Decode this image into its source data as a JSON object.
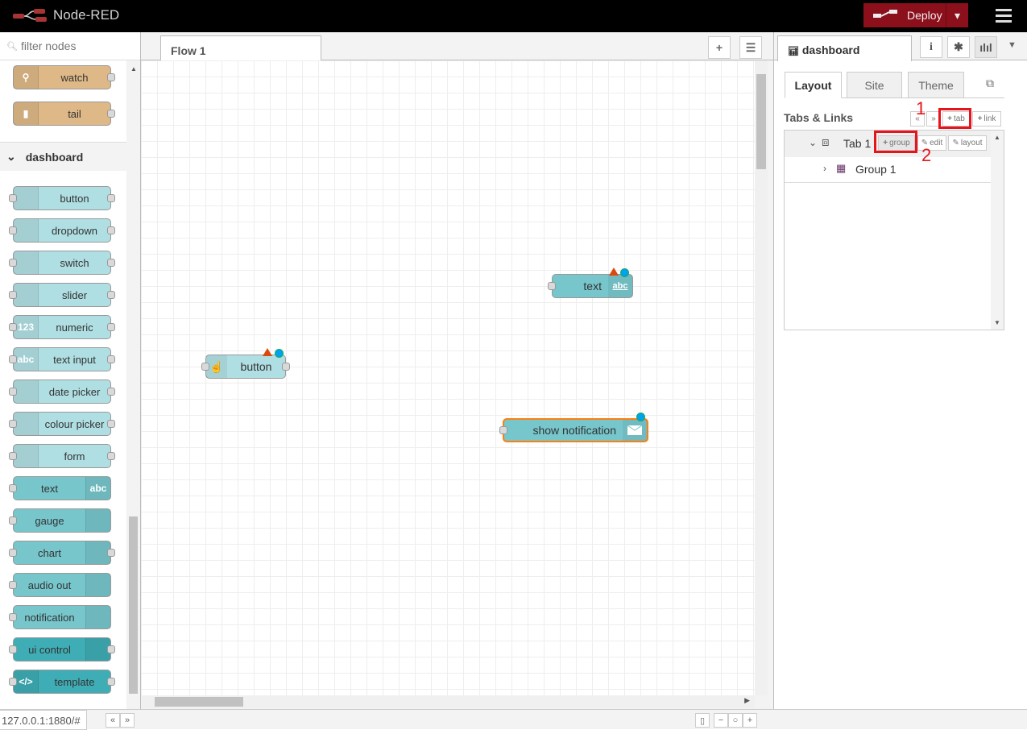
{
  "header": {
    "title": "Node-RED",
    "deploy_label": "Deploy"
  },
  "palette": {
    "filter_placeholder": "filter nodes",
    "category": "dashboard",
    "colors": {
      "input": "#b0dfe3",
      "output": "#77c6cc",
      "control": "#3fadb5",
      "common": "#deb887"
    },
    "common_nodes": [
      {
        "label": "watch",
        "icon": "magnifier-icon"
      },
      {
        "label": "tail",
        "icon": "file-icon"
      }
    ],
    "nodes": [
      {
        "label": "button",
        "icon": "hand-icon",
        "kind": "input",
        "side": "l",
        "in": true,
        "out": true
      },
      {
        "label": "dropdown",
        "icon": "list-icon",
        "kind": "input",
        "side": "l",
        "in": true,
        "out": true
      },
      {
        "label": "switch",
        "icon": "toggle-icon",
        "kind": "input",
        "side": "l",
        "in": true,
        "out": true
      },
      {
        "label": "slider",
        "icon": "sliders-icon",
        "kind": "input",
        "side": "l",
        "in": true,
        "out": true
      },
      {
        "label": "numeric",
        "icon": "numeric-icon",
        "kind": "input",
        "side": "l",
        "in": true,
        "out": true,
        "glyph": "123"
      },
      {
        "label": "text input",
        "icon": "text-input-icon",
        "kind": "input",
        "side": "l",
        "in": true,
        "out": true,
        "glyph": "abc"
      },
      {
        "label": "date picker",
        "icon": "calendar-icon",
        "kind": "input",
        "side": "l",
        "in": true,
        "out": true
      },
      {
        "label": "colour picker",
        "icon": "palette-icon",
        "kind": "input",
        "side": "l",
        "in": true,
        "out": true
      },
      {
        "label": "form",
        "icon": "form-icon",
        "kind": "input",
        "side": "l",
        "in": true,
        "out": true
      },
      {
        "label": "text",
        "icon": "abc-icon",
        "kind": "output",
        "side": "r",
        "in": true,
        "out": false,
        "glyph": "abc"
      },
      {
        "label": "gauge",
        "icon": "gauge-icon",
        "kind": "output",
        "side": "r",
        "in": true,
        "out": false
      },
      {
        "label": "chart",
        "icon": "chart-icon",
        "kind": "output",
        "side": "r",
        "in": true,
        "out": true
      },
      {
        "label": "audio out",
        "icon": "audio-icon",
        "kind": "output",
        "side": "r",
        "in": true,
        "out": false
      },
      {
        "label": "notification",
        "icon": "envelope-icon",
        "kind": "output",
        "side": "r",
        "in": true,
        "out": false
      },
      {
        "label": "ui control",
        "icon": "arrow-icon",
        "kind": "control",
        "side": "r",
        "in": true,
        "out": true
      },
      {
        "label": "template",
        "icon": "code-icon",
        "kind": "control",
        "side": "l",
        "in": true,
        "out": true,
        "glyph": "</>"
      }
    ]
  },
  "workspace": {
    "tab": "Flow 1",
    "flow_nodes": [
      {
        "label": "button",
        "glyph": ""
      },
      {
        "label": "text",
        "glyph": "abc"
      },
      {
        "label": "show notification",
        "glyph": ""
      }
    ]
  },
  "sidebar": {
    "tab": "dashboard",
    "subtabs": [
      "Layout",
      "Site",
      "Theme"
    ],
    "section_title": "Tabs & Links",
    "btn_tab": "tab",
    "btn_link": "link",
    "btn_group": "group",
    "btn_edit": "edit",
    "btn_layout": "layout",
    "tree": {
      "tab": "Tab 1",
      "group": "Group 1"
    },
    "annotations": [
      "1",
      "2"
    ]
  },
  "footer": {
    "url": "127.0.0.1:1880/#"
  }
}
